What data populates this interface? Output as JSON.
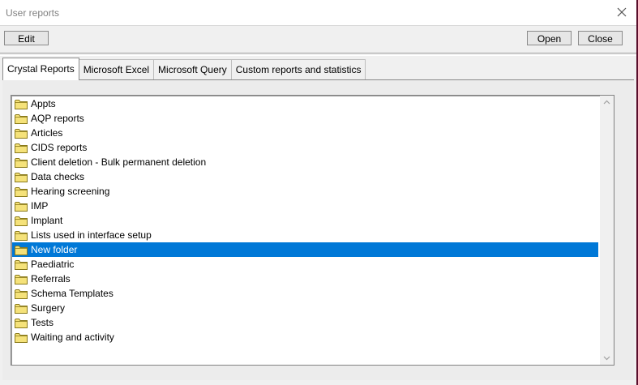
{
  "window": {
    "title": "User reports"
  },
  "toolbar": {
    "edit_label": "Edit",
    "open_label": "Open",
    "close_label": "Close"
  },
  "tabs": [
    {
      "label": "Crystal Reports",
      "active": true
    },
    {
      "label": "Microsoft Excel",
      "active": false
    },
    {
      "label": "Microsoft Query",
      "active": false
    },
    {
      "label": "Custom reports and statistics",
      "active": false
    }
  ],
  "tree": {
    "icon": "folder-icon",
    "selected_index": 10,
    "items": [
      "Appts",
      "AQP reports",
      "Articles",
      "CIDS reports",
      "Client deletion - Bulk permanent deletion",
      "Data checks",
      "Hearing screening",
      "IMP",
      "Implant",
      "Lists used in interface setup",
      "New folder",
      "Paediatric",
      "Referrals",
      "Schema Templates",
      "Surgery",
      "Tests",
      "Waiting and activity"
    ]
  },
  "colors": {
    "selection": "#0078d7",
    "folder_fill": "#f5e27a",
    "folder_stroke": "#8a7a1a"
  }
}
